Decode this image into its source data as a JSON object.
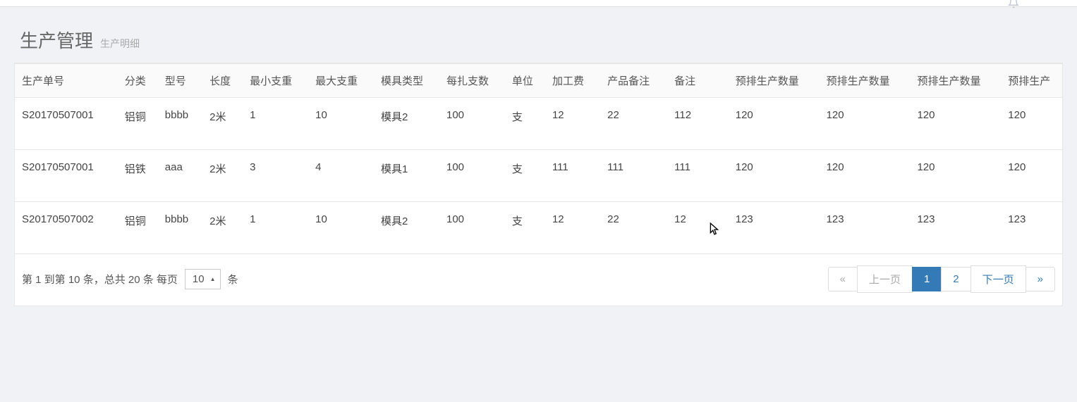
{
  "header": {
    "title": "生产管理",
    "subtitle": "生产明细"
  },
  "table": {
    "columns": [
      "生产单号",
      "分类",
      "型号",
      "长度",
      "最小支重",
      "最大支重",
      "模具类型",
      "每扎支数",
      "单位",
      "加工费",
      "产品备注",
      "备注",
      "预排生产数量",
      "预排生产数量",
      "预排生产数量",
      "预排生产"
    ],
    "colWidths": [
      "138px",
      "54px",
      "60px",
      "54px",
      "88px",
      "88px",
      "88px",
      "88px",
      "54px",
      "74px",
      "90px",
      "82px",
      "122px",
      "122px",
      "122px",
      "82px"
    ],
    "rows": [
      [
        "S20170507001",
        "铝铜",
        "bbbb",
        "2米",
        "1",
        "10",
        "模具2",
        "100",
        "支",
        "12",
        "22",
        "112",
        "120",
        "120",
        "120",
        "120"
      ],
      [
        "S20170507001",
        "铝铁",
        "aaa",
        "2米",
        "3",
        "4",
        "模具1",
        "100",
        "支",
        "111",
        "111",
        "111",
        "120",
        "120",
        "120",
        "120"
      ],
      [
        "S20170507002",
        "铝铜",
        "bbbb",
        "2米",
        "1",
        "10",
        "模具2",
        "100",
        "支",
        "12",
        "22",
        "12",
        "123",
        "123",
        "123",
        "123"
      ]
    ]
  },
  "pagination": {
    "info_part1": "第 1 到第 10 条，总共 20 条 每页",
    "pageSize": "10",
    "info_part2": "条",
    "first": "«",
    "prev": "上一页",
    "pages": [
      "1",
      "2"
    ],
    "activePage": "1",
    "next": "下一页",
    "last": "»"
  }
}
